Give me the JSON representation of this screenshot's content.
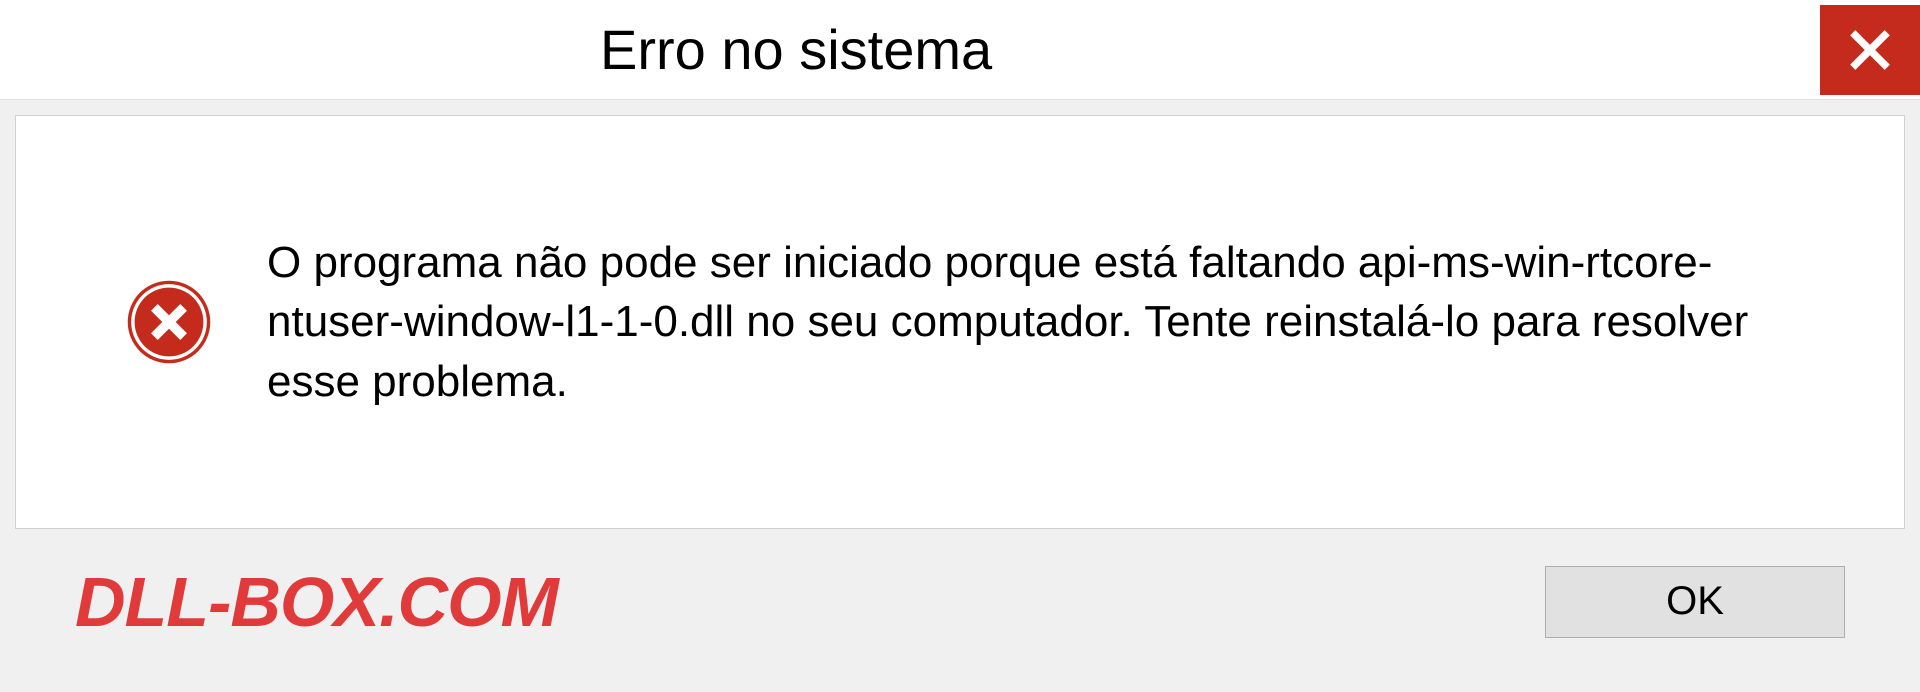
{
  "titlebar": {
    "title": "Erro no sistema"
  },
  "dialog": {
    "message": "O programa não pode ser iniciado porque está faltando api-ms-win-rtcore-ntuser-window-l1-1-0.dll no seu computador. Tente reinstalá-lo para resolver esse problema."
  },
  "footer": {
    "watermark": "DLL-BOX.COM",
    "ok_label": "OK"
  },
  "colors": {
    "close_button_bg": "#c42b1c",
    "error_icon_bg": "#c42b1c",
    "watermark_color": "#e03a3a"
  }
}
